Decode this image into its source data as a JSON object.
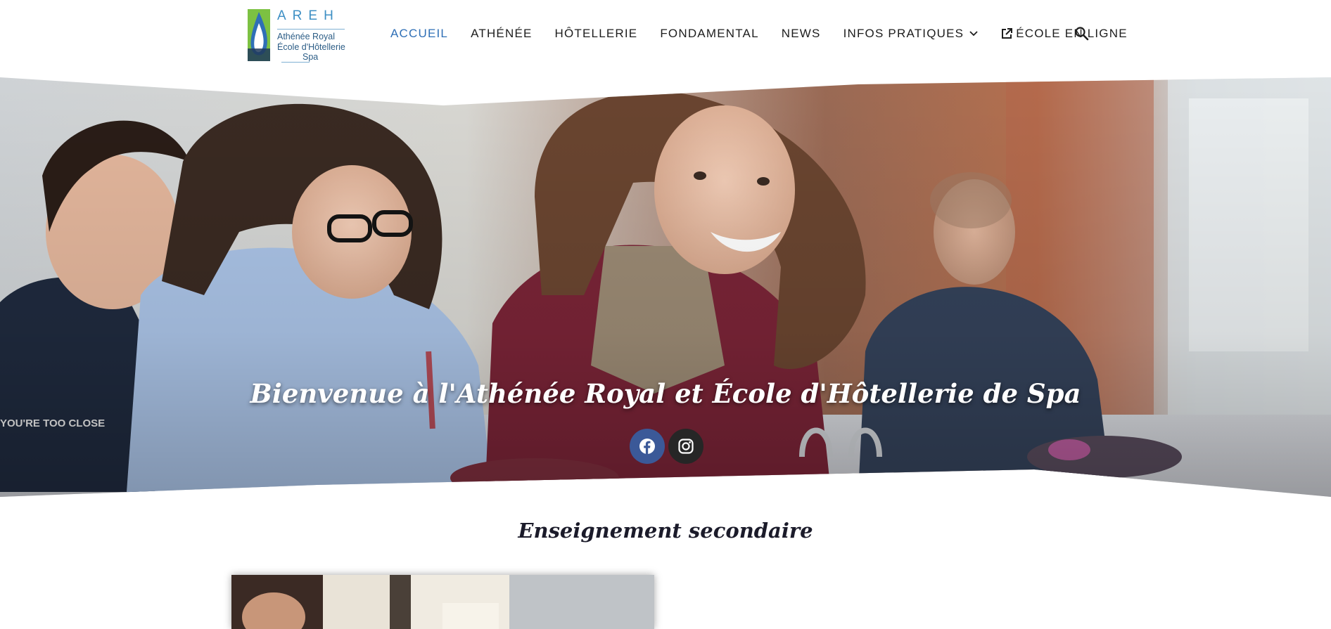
{
  "logo": {
    "acronym": "AREH",
    "line1": "Athénée Royal",
    "line2": "École d'Hôtellerie",
    "line3": "Spa"
  },
  "nav": {
    "items": [
      {
        "label": "ACCUEIL",
        "active": true
      },
      {
        "label": "ATHÉNÉE"
      },
      {
        "label": "HÔTELLERIE"
      },
      {
        "label": "FONDAMENTAL"
      },
      {
        "label": "NEWS"
      },
      {
        "label": "INFOS PRATIQUES",
        "icon": "chevron-down-icon"
      },
      {
        "label": "ÉCOLE EN LIGNE",
        "icon": "external-link-icon"
      }
    ],
    "search_icon": "search-icon"
  },
  "hero": {
    "title": "Bienvenue à l'Athénée Royal et École d'Hôtellerie de Spa",
    "social": [
      {
        "name": "facebook-icon",
        "color": "#3b5998"
      },
      {
        "name": "instagram-icon",
        "color": "#262626"
      }
    ]
  },
  "sections": {
    "secondary_title": "Enseignement secondaire"
  },
  "colors": {
    "accent": "#2f6fb6",
    "text": "#1d1d1d"
  }
}
